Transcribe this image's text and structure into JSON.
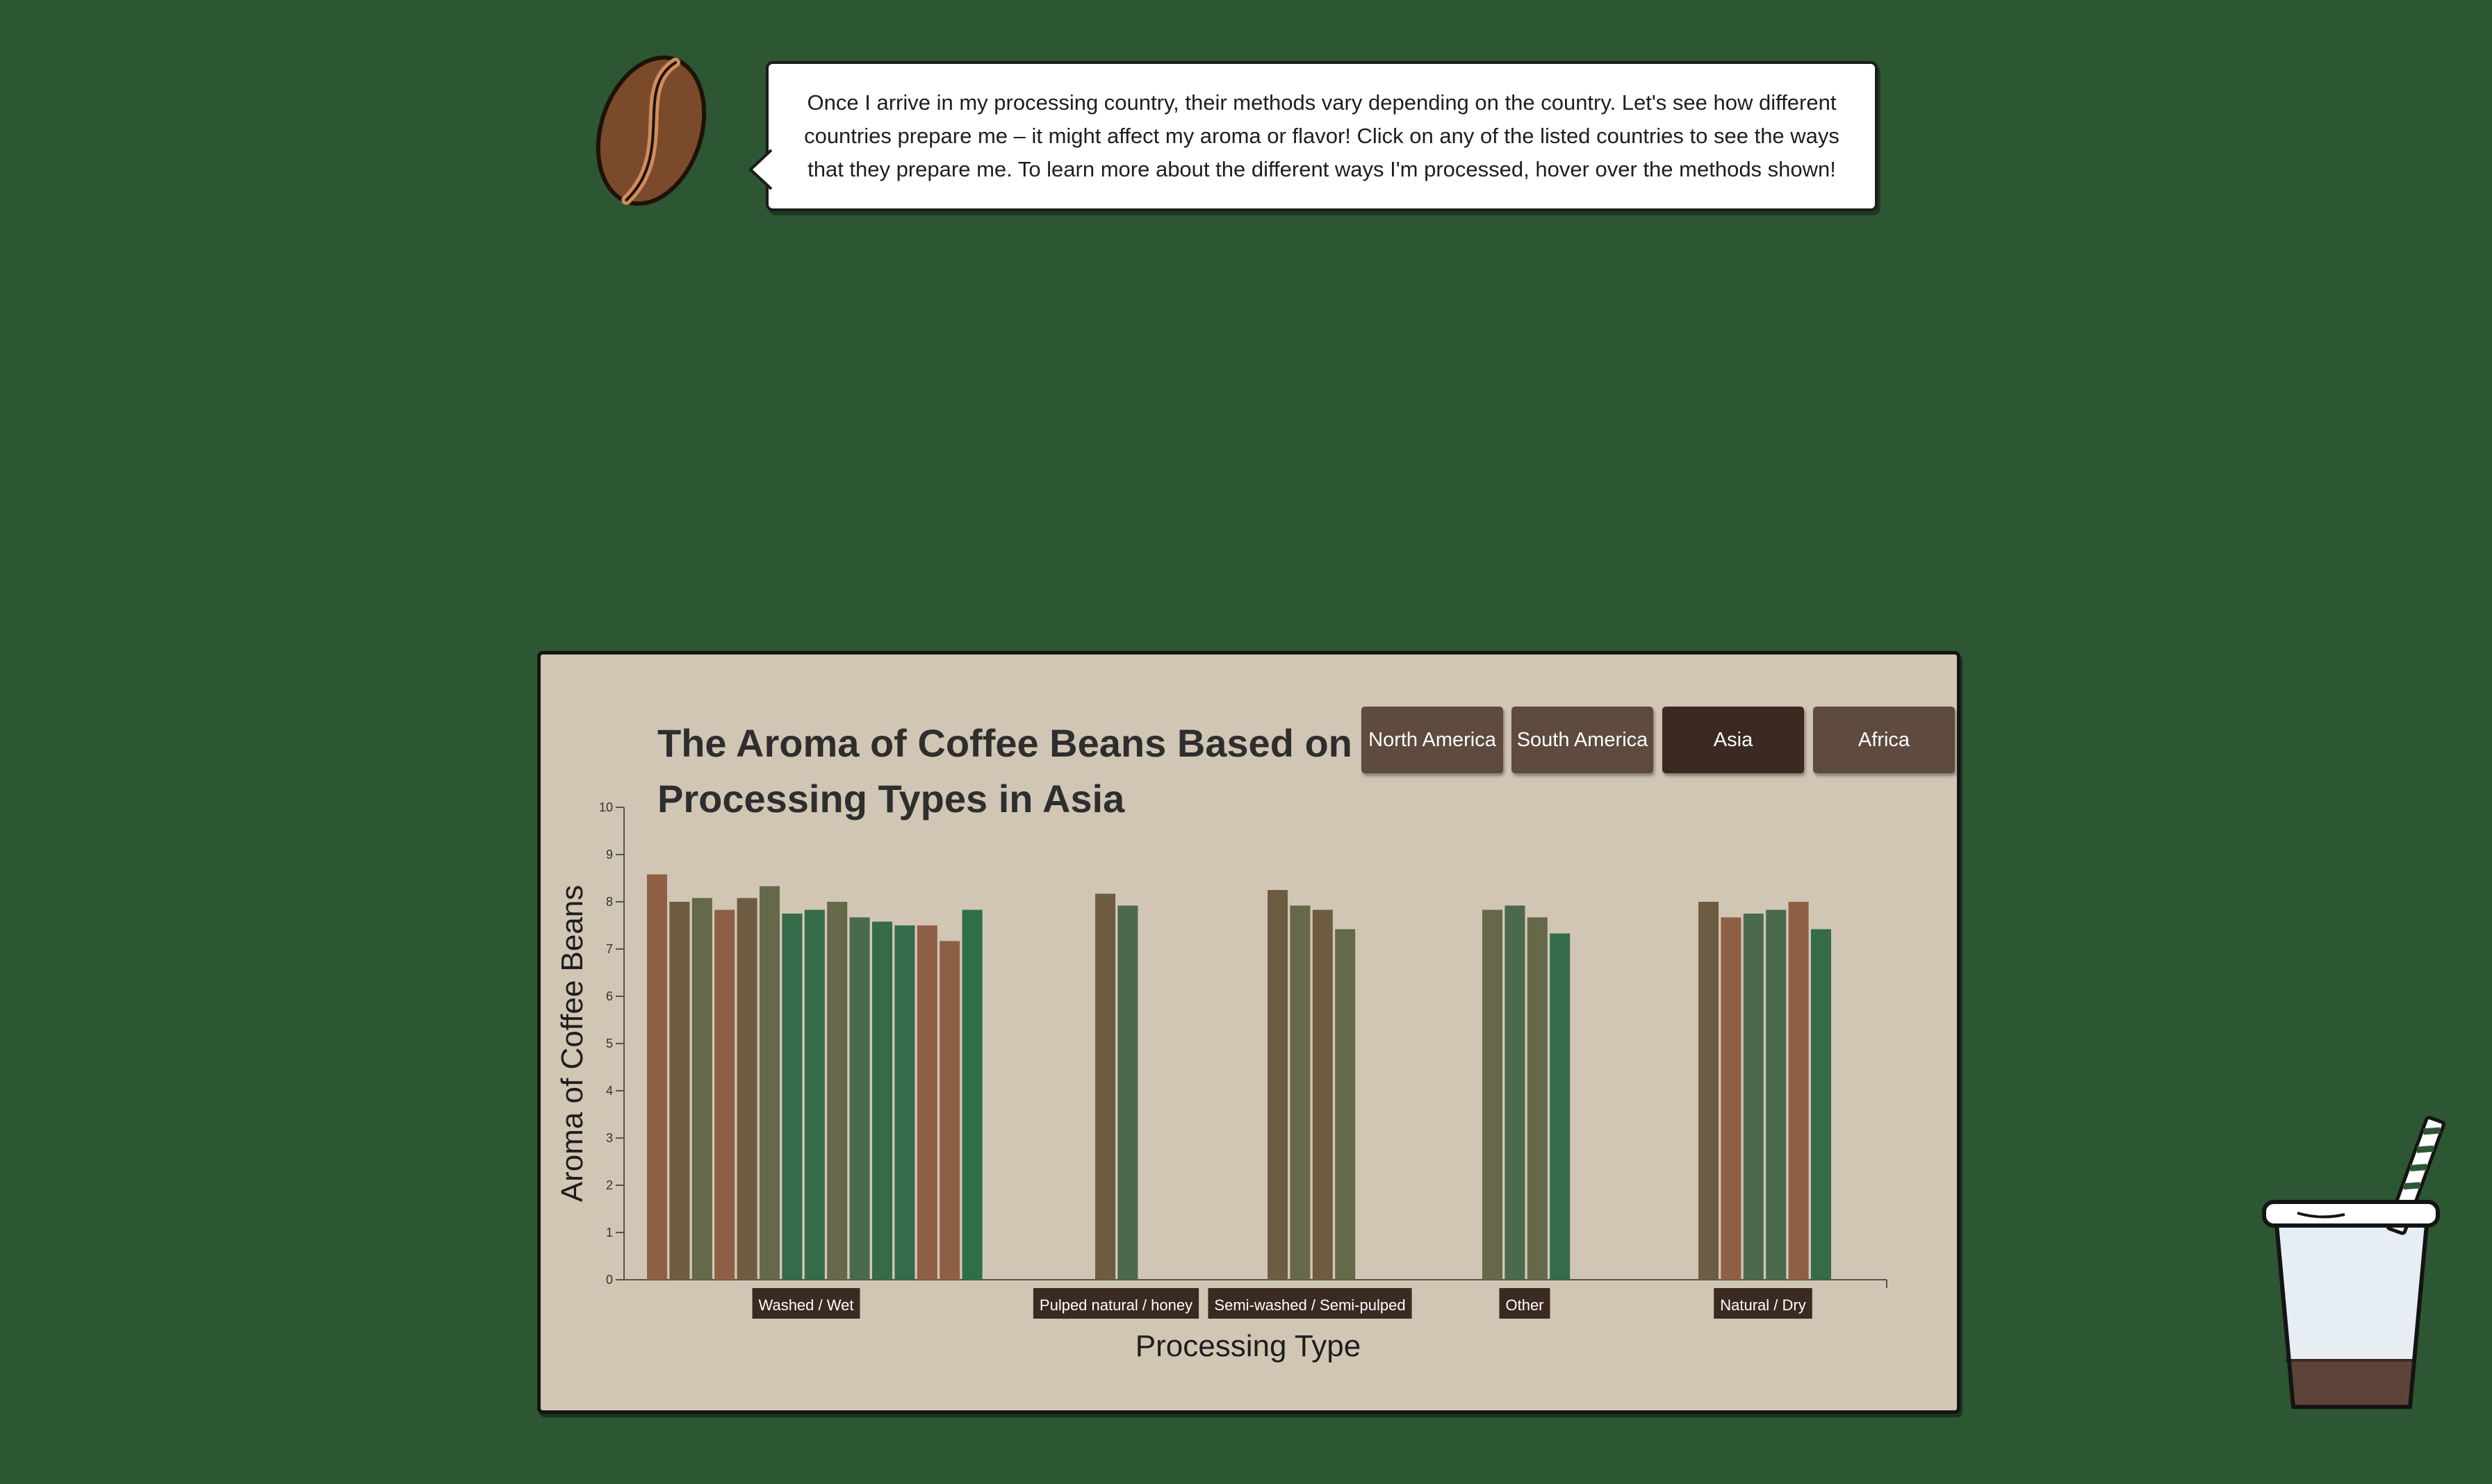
{
  "intro": {
    "text": "Once I arrive in my processing country, their methods vary depending on the country. Let's see how different countries prepare me – it might affect my aroma or flavor! Click on any of the listed countries to see the ways that they prepare me. To learn more about the different ways I'm processed, hover over the methods shown!"
  },
  "region_buttons": [
    {
      "label": "North America",
      "selected": false
    },
    {
      "label": "South America",
      "selected": false
    },
    {
      "label": "Asia",
      "selected": true
    },
    {
      "label": "Africa",
      "selected": false
    }
  ],
  "colors": {
    "background": "#2d5633",
    "panel": "#d1c6b4",
    "button": "#5e4a3e",
    "button_selected": "#3a2a22",
    "bar_brown": "#8f5f45",
    "bar_olive_brown": "#6e5c42",
    "bar_olive": "#66684a",
    "bar_sage": "#4a6a4b",
    "bar_green": "#356b48",
    "bar_bright_green": "#2e7045"
  },
  "chart_data": {
    "type": "bar",
    "title": "The Aroma of Coffee Beans Based on Processing Types in Asia",
    "xlabel": "Processing Type",
    "ylabel": "Aroma of Coffee Beans",
    "ylim": [
      0,
      10
    ],
    "yticks": [
      0,
      1,
      2,
      3,
      4,
      5,
      6,
      7,
      8,
      9,
      10
    ],
    "grid": false,
    "categories": [
      "Washed / Wet",
      "Pulped natural / honey",
      "Semi-washed / Semi-pulped",
      "Other",
      "Natural / Dry"
    ],
    "groups": [
      {
        "category": "Washed / Wet",
        "values": [
          8.58,
          8.0,
          8.08,
          7.83,
          8.08,
          8.33,
          7.75,
          7.83,
          8.0,
          7.67,
          7.58,
          7.5,
          7.5,
          7.17,
          7.83
        ],
        "colors": [
          "#8f5f45",
          "#6e5c42",
          "#66684a",
          "#8f5f45",
          "#6e5c42",
          "#66684a",
          "#356b48",
          "#356b48",
          "#66684a",
          "#4a6a4b",
          "#356b48",
          "#356b48",
          "#8f5f45",
          "#8f5f45",
          "#2e7045"
        ]
      },
      {
        "category": "Pulped natural / honey",
        "values": [
          8.17,
          7.92
        ],
        "colors": [
          "#6e5c42",
          "#4a6a4b"
        ]
      },
      {
        "category": "Semi-washed / Semi-pulped",
        "values": [
          8.25,
          7.92,
          7.83,
          7.42
        ],
        "colors": [
          "#6e5c42",
          "#66684a",
          "#6e5c42",
          "#66684a"
        ]
      },
      {
        "category": "Other",
        "values": [
          7.83,
          7.92,
          7.67,
          7.33
        ],
        "colors": [
          "#66684a",
          "#4a6a4b",
          "#66684a",
          "#356b48"
        ]
      },
      {
        "category": "Natural / Dry",
        "values": [
          8.0,
          7.67,
          7.75,
          7.83,
          8.0,
          7.42
        ],
        "colors": [
          "#6e5c42",
          "#8f5f45",
          "#4a6a4b",
          "#4a6a4b",
          "#8f5f45",
          "#356b48"
        ]
      }
    ]
  }
}
